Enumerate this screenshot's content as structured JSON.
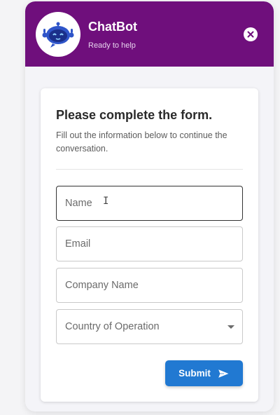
{
  "header": {
    "title": "ChatBot",
    "subtitle": "Ready to help",
    "avatar_icon": "robot-icon",
    "close_icon": "close-icon",
    "accent_color": "#6f0f7c"
  },
  "form": {
    "title": "Please complete the form.",
    "description": "Fill out the information below to continue the conversation.",
    "fields": {
      "name_placeholder": "Name",
      "email_placeholder": "Email",
      "company_placeholder": "Company Name",
      "country_placeholder": "Country of Operation"
    },
    "submit_label": "Submit",
    "submit_icon": "send-icon",
    "submit_color": "#2179d2"
  }
}
